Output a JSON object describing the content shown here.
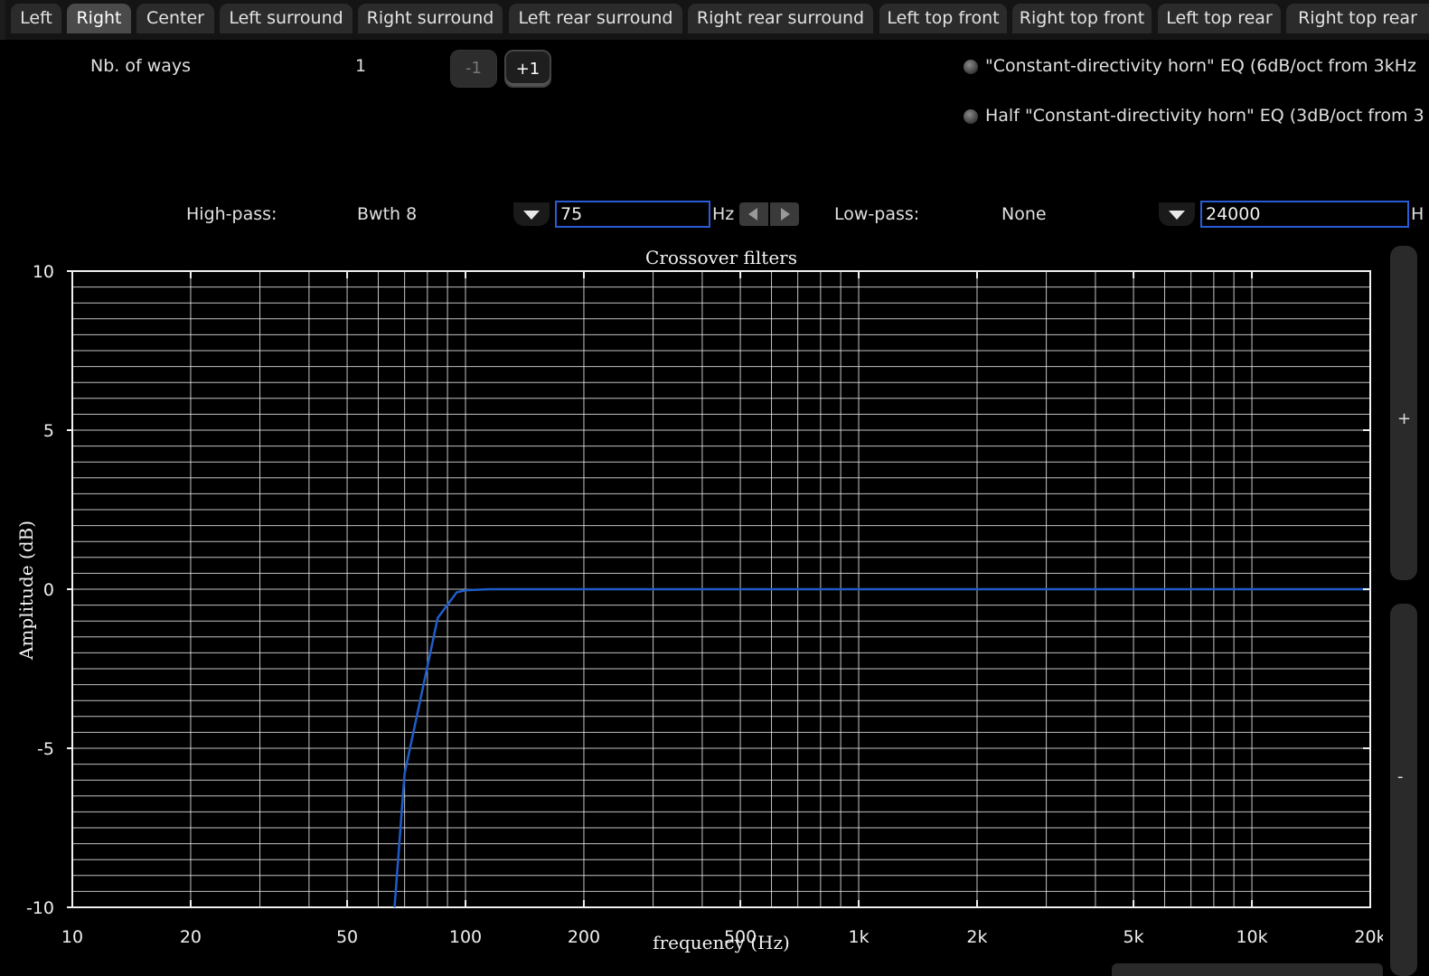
{
  "tabs": [
    {
      "label": "Left"
    },
    {
      "label": "Right"
    },
    {
      "label": "Center"
    },
    {
      "label": "Left surround"
    },
    {
      "label": "Right surround"
    },
    {
      "label": "Left rear surround"
    },
    {
      "label": "Right rear surround"
    },
    {
      "label": "Left top front"
    },
    {
      "label": "Right top front"
    },
    {
      "label": "Left top rear"
    },
    {
      "label": "Right top rear"
    }
  ],
  "active_tab": "Right",
  "ways": {
    "label": "Nb. of ways",
    "value": "1",
    "minus_label": "-1",
    "plus_label": "+1"
  },
  "eq_options": [
    {
      "label": "\"Constant-directivity horn\" EQ (6dB/oct from 3kHz"
    },
    {
      "label": "Half \"Constant-directivity horn\" EQ (3dB/oct from 3"
    }
  ],
  "highpass": {
    "label": "High-pass:",
    "type": "Bwth 8",
    "value": "75",
    "unit": "Hz"
  },
  "lowpass": {
    "label": "Low-pass:",
    "type": "None",
    "value": "24000",
    "unit": "H"
  },
  "scroll": {
    "plus": "+",
    "minus": "-"
  },
  "colors": {
    "accent_border": "#2a5cd6",
    "series": "#1f5cc9",
    "grid": "#e6e6e6"
  },
  "chart_data": {
    "type": "line",
    "title": "Crossover filters",
    "xlabel": "frequency (Hz)",
    "ylabel": "Amplitude (dB)",
    "xscale": "log",
    "xlim": [
      10,
      20000
    ],
    "ylim": [
      -10,
      10
    ],
    "x_ticks": [
      {
        "value": 10,
        "label": "10"
      },
      {
        "value": 20,
        "label": "20"
      },
      {
        "value": 50,
        "label": "50"
      },
      {
        "value": 100,
        "label": "100"
      },
      {
        "value": 200,
        "label": "200"
      },
      {
        "value": 500,
        "label": "500"
      },
      {
        "value": 1000,
        "label": "1k"
      },
      {
        "value": 2000,
        "label": "2k"
      },
      {
        "value": 5000,
        "label": "5k"
      },
      {
        "value": 10000,
        "label": "10k"
      },
      {
        "value": 20000,
        "label": "20k"
      }
    ],
    "y_ticks": [
      {
        "value": 10,
        "label": "10"
      },
      {
        "value": 5,
        "label": "5"
      },
      {
        "value": 0,
        "label": "0"
      },
      {
        "value": -5,
        "label": "-5"
      },
      {
        "value": -10,
        "label": "-10"
      }
    ],
    "grid": true,
    "series": [
      {
        "x": [
          66,
          70,
          85,
          95,
          100,
          115,
          20000
        ],
        "y": [
          -10,
          -5.8,
          -0.9,
          -0.1,
          -0.03,
          0,
          0
        ]
      }
    ]
  }
}
